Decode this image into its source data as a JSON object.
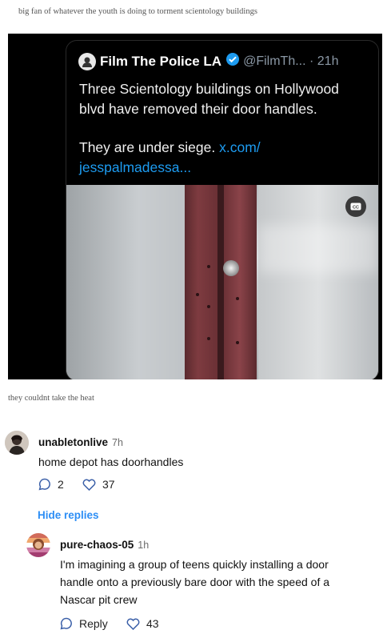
{
  "post": {
    "caption": "big fan of whatever the youth is doing to torment scientology buildings"
  },
  "tweet": {
    "author": "Film The Police LA",
    "handle_time": "@FilmTh... · 21h",
    "line1": "Three Scientology buildings on Hollywood",
    "line2": "blvd have removed their door handles.",
    "line3": "They are under siege.",
    "link1": "x.com/",
    "link2": "jesspalmadessa..."
  },
  "reblog": {
    "caption": "they couldnt take the heat"
  },
  "replies": [
    {
      "username": "unabletonlive",
      "time": "7h",
      "text": "home depot has doorhandles",
      "comment_count": "2",
      "like_count": "37"
    },
    {
      "username": "pure-chaos-05",
      "time": "1h",
      "lines": [
        "I'm imagining a group of teens quickly installing a door",
        "handle onto  a previously bare door with the speed of a",
        "Nascar pit crew"
      ],
      "reply_label": "Reply",
      "like_count": "43"
    }
  ],
  "hide_replies_label": "Hide replies",
  "colors": {
    "link": "#1d9bf0",
    "accent": "#2d8ef5",
    "verified": "#1d9bf0",
    "door_frame": "#7e3b40"
  },
  "icons": [
    "verified-badge-icon",
    "closed-captions-icon",
    "comment-icon",
    "heart-icon"
  ]
}
